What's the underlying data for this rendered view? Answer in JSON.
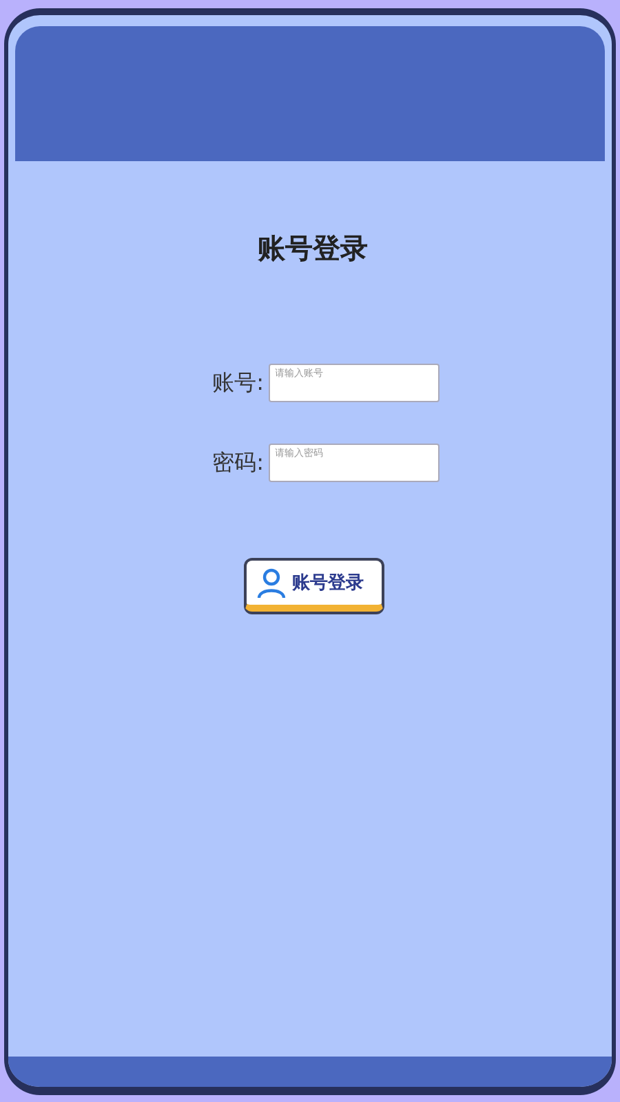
{
  "title": "账号登录",
  "fields": [
    {
      "label": "账号:",
      "placeholder": "请输入账号"
    },
    {
      "label": "密码:",
      "placeholder": "请输入密码"
    }
  ],
  "login_button": {
    "label": "账号登录"
  }
}
